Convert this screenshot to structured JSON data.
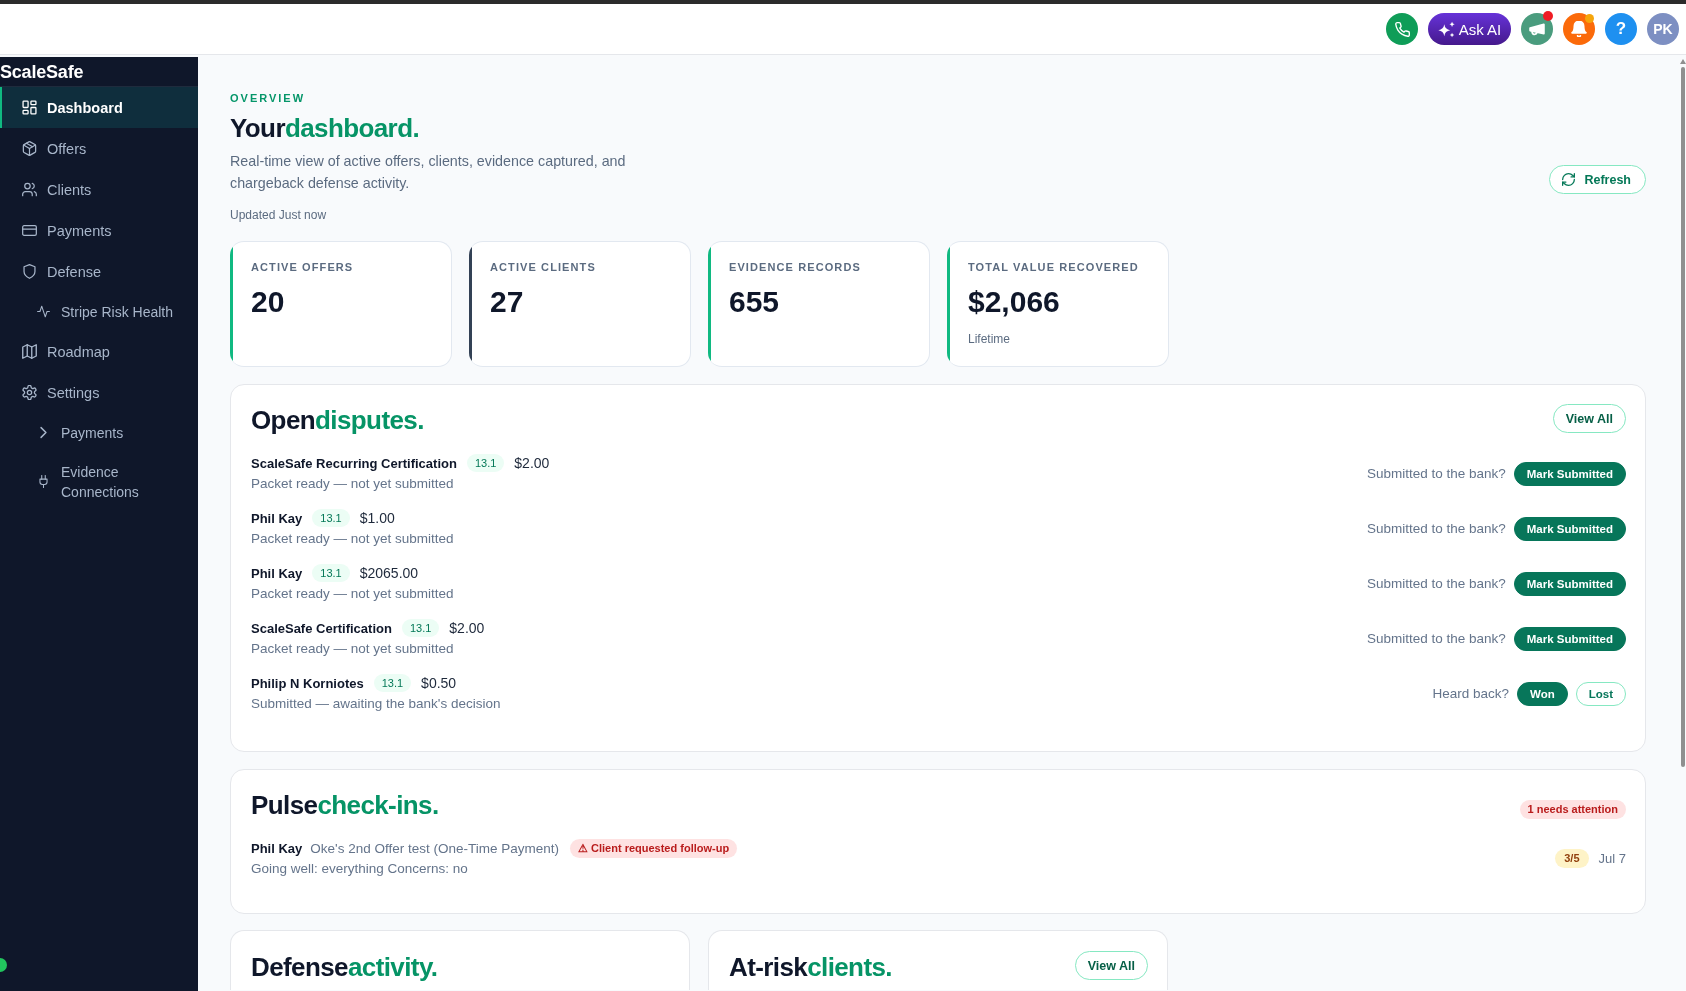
{
  "top_bar": {
    "ask_ai": {
      "label": "Ask AI"
    },
    "announcements": {
      "unread": true
    },
    "notifications": {
      "unread": true
    },
    "help": {
      "label": "?"
    },
    "avatar": {
      "initials": "PK"
    }
  },
  "sidebar": {
    "brand": "ScaleSafe",
    "items": [
      {
        "label": "Dashboard",
        "selected": true
      },
      {
        "label": "Offers",
        "selected": false
      },
      {
        "label": "Clients",
        "selected": false
      },
      {
        "label": "Payments",
        "selected": false
      },
      {
        "label": "Defense",
        "selected": false,
        "children": [
          {
            "label": "Stripe Risk Health",
            "selected": false
          }
        ]
      },
      {
        "label": "Roadmap",
        "selected": false
      },
      {
        "label": "Settings",
        "selected": false,
        "children": [
          {
            "label": "Payments",
            "selected": false
          },
          {
            "label": "Evidence Connections",
            "selected": false
          }
        ]
      }
    ]
  },
  "overview": {
    "eyebrow": "OVERVIEW",
    "title": "Your",
    "title_accent": "dashboard.",
    "description": "Real-time view of active offers, clients, evidence captured, and chargeback defense activity.",
    "updated": "Updated Just now",
    "refresh_button": "Refresh"
  },
  "stats": [
    {
      "label": "ACTIVE OFFERS",
      "value": "20",
      "color": "#10b981"
    },
    {
      "label": "ACTIVE CLIENTS",
      "value": "27",
      "color": "#334155"
    },
    {
      "label": "EVIDENCE RECORDS",
      "value": "655",
      "color": "#10b981"
    },
    {
      "label": "TOTAL VALUE RECOVERED",
      "value": "$2,066",
      "note": "Lifetime",
      "color": "#10b981"
    }
  ],
  "open_disputes": {
    "title": "Open",
    "title_accent": "disputes.",
    "view_all": "View All",
    "rows": [
      {
        "name": "ScaleSafe Recurring Certification",
        "code": "13.1",
        "amount": "$2.00",
        "status": "Packet ready — not yet submitted",
        "prompt": "Submitted to the bank?",
        "actions": [
          {
            "label": "Mark Submitted",
            "kind": "primary"
          }
        ]
      },
      {
        "name": "Phil Kay",
        "code": "13.1",
        "amount": "$1.00",
        "status": "Packet ready — not yet submitted",
        "prompt": "Submitted to the bank?",
        "actions": [
          {
            "label": "Mark Submitted",
            "kind": "primary"
          }
        ]
      },
      {
        "name": "Phil Kay",
        "code": "13.1",
        "amount": "$2065.00",
        "status": "Packet ready — not yet submitted",
        "prompt": "Submitted to the bank?",
        "actions": [
          {
            "label": "Mark Submitted",
            "kind": "primary"
          }
        ]
      },
      {
        "name": "ScaleSafe Certification",
        "code": "13.1",
        "amount": "$2.00",
        "status": "Packet ready — not yet submitted",
        "prompt": "Submitted to the bank?",
        "actions": [
          {
            "label": "Mark Submitted",
            "kind": "primary"
          }
        ]
      },
      {
        "name": "Philip N Korniotes",
        "code": "13.1",
        "amount": "$0.50",
        "status": "Submitted — awaiting the bank's decision",
        "prompt": "Heard back?",
        "actions": [
          {
            "label": "Won",
            "kind": "primary"
          },
          {
            "label": "Lost",
            "kind": "outline"
          }
        ]
      }
    ]
  },
  "pulse_checkins": {
    "title": "Pulse",
    "title_accent": "check-ins.",
    "attention_badge": "1 needs attention",
    "entries": [
      {
        "client": "Phil Kay",
        "offer": "Oke's 2nd Offer test (One-Time Payment)",
        "flag": "⚠ Client requested follow-up",
        "summary": "Going well: everything Concerns: no",
        "score": "3/5",
        "date": "Jul 7"
      }
    ]
  },
  "defense_activity": {
    "title": "Defense",
    "title_accent": "activity."
  },
  "at_risk_clients": {
    "title": "At-risk",
    "title_accent": "clients.",
    "view_all": "View All"
  }
}
